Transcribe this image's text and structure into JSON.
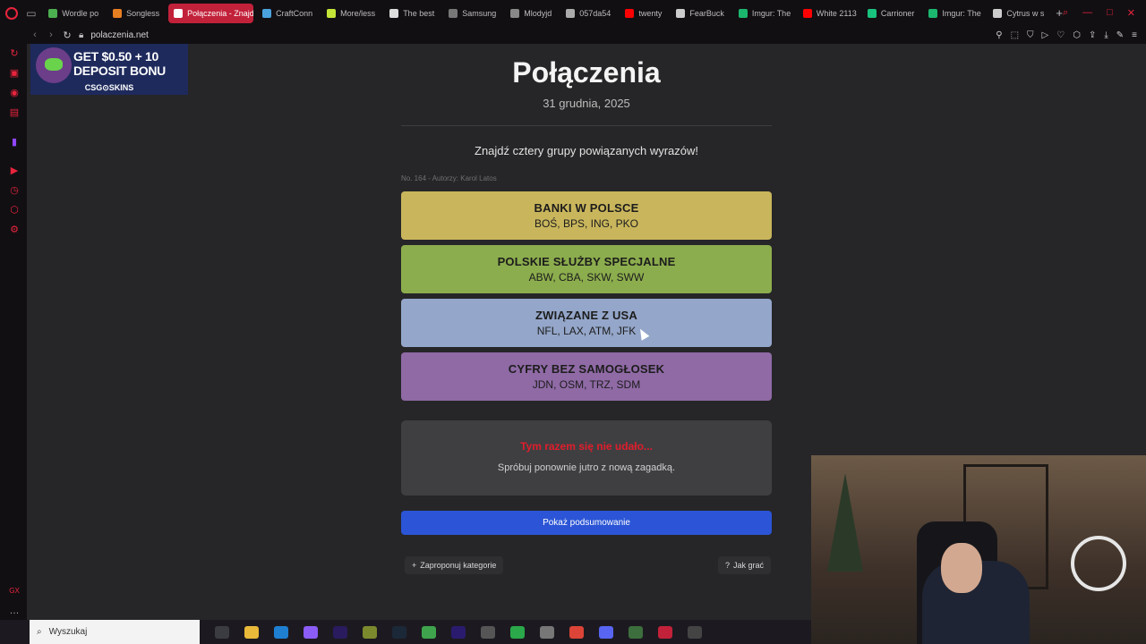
{
  "browser": {
    "tabs": [
      {
        "label": "Wordle po",
        "fav_color": "#4caf50",
        "active": false
      },
      {
        "label": "Songless",
        "fav_color": "#e67e22",
        "active": false
      },
      {
        "label": "Połączenia - Znajd",
        "fav_color": "#ffffff",
        "active": true
      },
      {
        "label": "CraftConn",
        "fav_color": "#4aa3df",
        "active": false
      },
      {
        "label": "More/less",
        "fav_color": "#c4e538",
        "active": false
      },
      {
        "label": "The best",
        "fav_color": "#dddddd",
        "active": false
      },
      {
        "label": "Samsung",
        "fav_color": "#777777",
        "active": false
      },
      {
        "label": "Mlodyjd",
        "fav_color": "#888888",
        "active": false
      },
      {
        "label": "057da54",
        "fav_color": "#aaaaaa",
        "active": false
      },
      {
        "label": "twenty",
        "fav_color": "#ff0000",
        "active": false
      },
      {
        "label": "FearBuck",
        "fav_color": "#cccccc",
        "active": false
      },
      {
        "label": "Imgur: The",
        "fav_color": "#1bb76e",
        "active": false
      },
      {
        "label": "White 2113",
        "fav_color": "#ff0000",
        "active": false
      },
      {
        "label": "Carrioner",
        "fav_color": "#19c37d",
        "active": false
      },
      {
        "label": "Imgur: The",
        "fav_color": "#1bb76e",
        "active": false
      },
      {
        "label": "Cytrus w s",
        "fav_color": "#cccccc",
        "active": false
      }
    ],
    "new_tab": "+",
    "url": "polaczenia.net"
  },
  "ad": {
    "line1": "GET $0.50 + 10",
    "line2": "DEPOSIT BONU",
    "brand": "CSG⊙SKINS"
  },
  "page": {
    "title": "Połączenia",
    "date": "31 grudnia, 2025",
    "instruction": "Znajdź cztery grupy powiązanych wyrazów!",
    "meta": "No. 164 - Autorzy: Karol Latos"
  },
  "groups": [
    {
      "title": "BANKI W POLSCE",
      "words": "BOŚ, BPS, ING, PKO",
      "color": "#c9b65c"
    },
    {
      "title": "POLSKIE SŁUŻBY SPECJALNE",
      "words": "ABW, CBA, SKW, SWW",
      "color": "#8cad4d"
    },
    {
      "title": "ZWIĄZANE Z USA",
      "words": "NFL, LAX, ATM, JFK",
      "color": "#94a6c9"
    },
    {
      "title": "CYFRY BEZ SAMOGŁOSEK",
      "words": "JDN, OSM, TRZ, SDM",
      "color": "#8f6aa5"
    }
  ],
  "result": {
    "fail_text": "Tym razem się nie udało...",
    "retry_text": "Spróbuj ponownie jutro z nową zagadką."
  },
  "buttons": {
    "summary": "Pokaż podsumowanie",
    "suggest": "Zaproponuj kategorie",
    "how_to": "Jak grać"
  },
  "taskbar": {
    "search_placeholder": "Wyszukaj"
  }
}
